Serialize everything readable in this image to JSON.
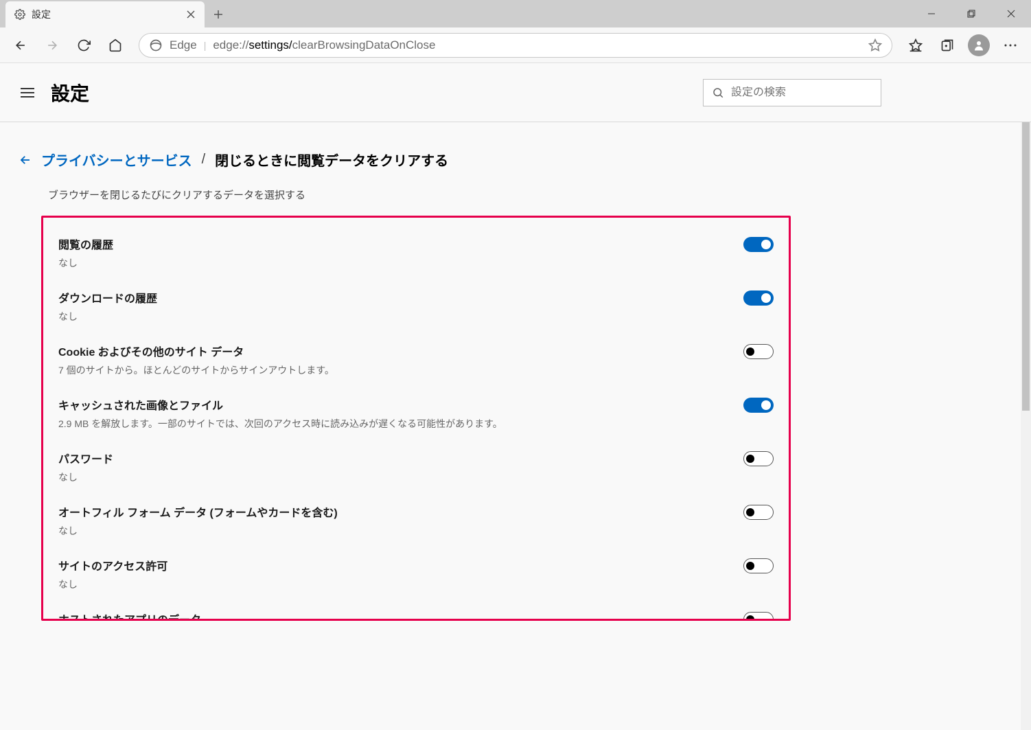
{
  "tab": {
    "title": "設定"
  },
  "address": {
    "brand": "Edge",
    "url_prefix": "edge://",
    "url_mid": "settings/",
    "url_end": "clearBrowsingDataOnClose"
  },
  "header": {
    "title": "設定",
    "search_placeholder": "設定の検索"
  },
  "breadcrumb": {
    "link": "プライバシーとサービス",
    "separator": "/",
    "current": "閉じるときに閲覧データをクリアする"
  },
  "subtitle": "ブラウザーを閉じるたびにクリアするデータを選択する",
  "options": [
    {
      "title": "閲覧の履歴",
      "desc": "なし",
      "on": true
    },
    {
      "title": "ダウンロードの履歴",
      "desc": "なし",
      "on": true
    },
    {
      "title": "Cookie およびその他のサイト データ",
      "desc": "7 個のサイトから。ほとんどのサイトからサインアウトします。",
      "on": false
    },
    {
      "title": "キャッシュされた画像とファイル",
      "desc": "2.9 MB を解放します。一部のサイトでは、次回のアクセス時に読み込みが遅くなる可能性があります。",
      "on": true
    },
    {
      "title": "パスワード",
      "desc": "なし",
      "on": false
    },
    {
      "title": "オートフィル フォーム データ (フォームやカードを含む)",
      "desc": "なし",
      "on": false
    },
    {
      "title": "サイトのアクセス許可",
      "desc": "なし",
      "on": false
    },
    {
      "title": "ホストされたアプリのデータ",
      "desc": "",
      "on": false
    }
  ]
}
